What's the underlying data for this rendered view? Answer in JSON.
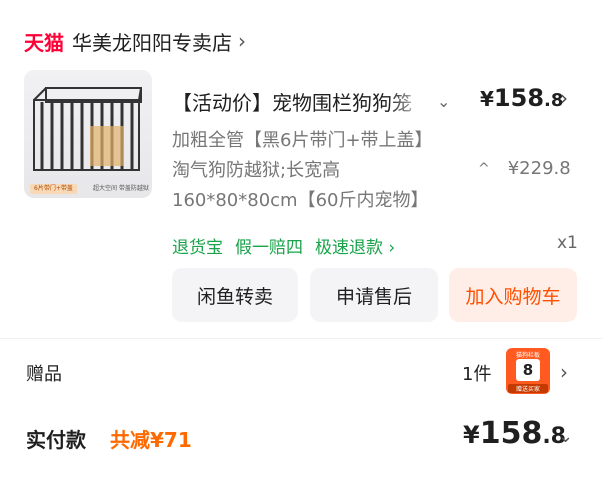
{
  "store": {
    "logo_text": "天猫",
    "name": "华美龙阳阳专卖店",
    "chevron": "›"
  },
  "product": {
    "title": "【活动价】宠物围栏狗狗笼",
    "title_chevron": "⌄",
    "price_symbol": "¥",
    "price_int": "158",
    "price_dec": ".8",
    "price_chevron": "›",
    "spec_lines": [
      "加粗全管【黑6片带门+带上盖】",
      "淘气狗防越狱;长宽高",
      "160*80*80cm【60斤内宠物】"
    ],
    "caret_up": "^",
    "original_price": "¥229.8",
    "thumb_banner": "6片带门+带盖",
    "thumb_banner2": "超大空间 带盖防越狱",
    "thumb_icon": "dog-cage-product-image"
  },
  "services": [
    "退货宝",
    "假一赔四",
    "极速退款 ›"
  ],
  "quantity": "x1",
  "buttons": {
    "resell": "闲鱼转卖",
    "aftersale": "申请售后",
    "add_to_cart": "加入购物车"
  },
  "gift": {
    "label": "赠品",
    "count": "1件",
    "image_top": "猫狗栏板",
    "image_card": "8",
    "image_bottom": "赠送买家",
    "chevron": "›"
  },
  "payment": {
    "label": "实付款",
    "discount": "共减¥71",
    "total_symbol": "¥",
    "total_int": "158",
    "total_dec": ".8",
    "chevron": "⌄"
  },
  "colors": {
    "tmall_red": "#ff0036",
    "green": "#1aa34a",
    "orange": "#ff5000",
    "discount_orange": "#ff6a00"
  }
}
